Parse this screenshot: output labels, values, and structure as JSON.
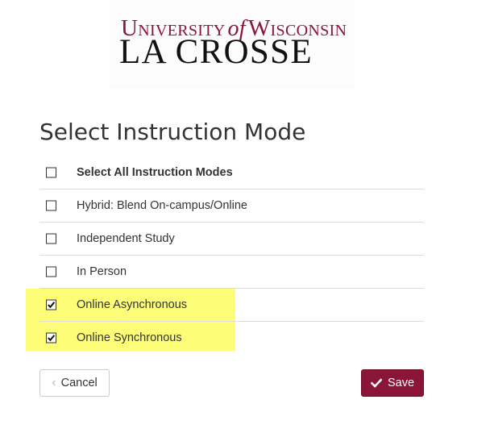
{
  "logo": {
    "line1_prefix": "University",
    "line1_of": "of",
    "line1_suffix": "Wisconsin",
    "line2": "LA CROSSE"
  },
  "page_title": "Select Instruction Mode",
  "modes": [
    {
      "label": "Select All Instruction Modes",
      "checked": false,
      "bold": true
    },
    {
      "label": "Hybrid: Blend On-campus/Online",
      "checked": false,
      "bold": false
    },
    {
      "label": "Independent Study",
      "checked": false,
      "bold": false
    },
    {
      "label": "In Person",
      "checked": false,
      "bold": false
    },
    {
      "label": "Online Asynchronous",
      "checked": true,
      "bold": false
    },
    {
      "label": "Online Synchronous",
      "checked": true,
      "bold": false
    }
  ],
  "buttons": {
    "cancel_label": "Cancel",
    "save_label": "Save"
  },
  "colors": {
    "brand": "#8b1538",
    "highlight": "#fdfd55"
  },
  "icons": {
    "cancel": "chevron-left-icon",
    "save": "checkmark-icon"
  }
}
